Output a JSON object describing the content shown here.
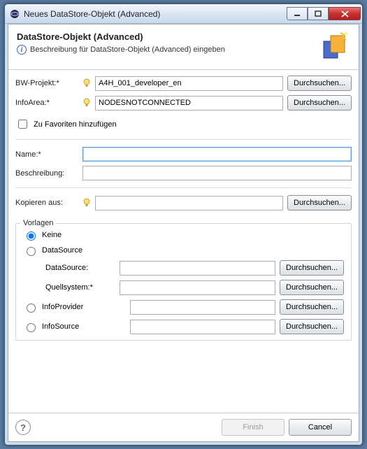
{
  "window": {
    "title": "Neues DataStore-Objekt (Advanced)"
  },
  "header": {
    "title": "DataStore-Objekt (Advanced)",
    "description": "Beschreibung für DataStore-Objekt (Advanced) eingeben"
  },
  "labels": {
    "bw_project": "BW-Projekt:*",
    "infoarea": "InfoArea:*",
    "add_favorites": "Zu Favoriten hinzufügen",
    "name": "Name:*",
    "description": "Beschreibung:",
    "copy_from": "Kopieren aus:",
    "browse": "Durchsuchen..."
  },
  "values": {
    "bw_project": "A4H_001_developer_en",
    "infoarea": "NODESNOTCONNECTED",
    "name": "",
    "description": "",
    "copy_from": ""
  },
  "templates": {
    "group_title": "Vorlagen",
    "options": {
      "none": "Keine",
      "datasource": "DataSource",
      "infoprovider": "InfoProvider",
      "infosource": "InfoSource"
    },
    "sub": {
      "datasource": "DataSource:",
      "source_system": "Quellsystem:*"
    },
    "selected": "none"
  },
  "footer": {
    "finish": "Finish",
    "cancel": "Cancel"
  }
}
